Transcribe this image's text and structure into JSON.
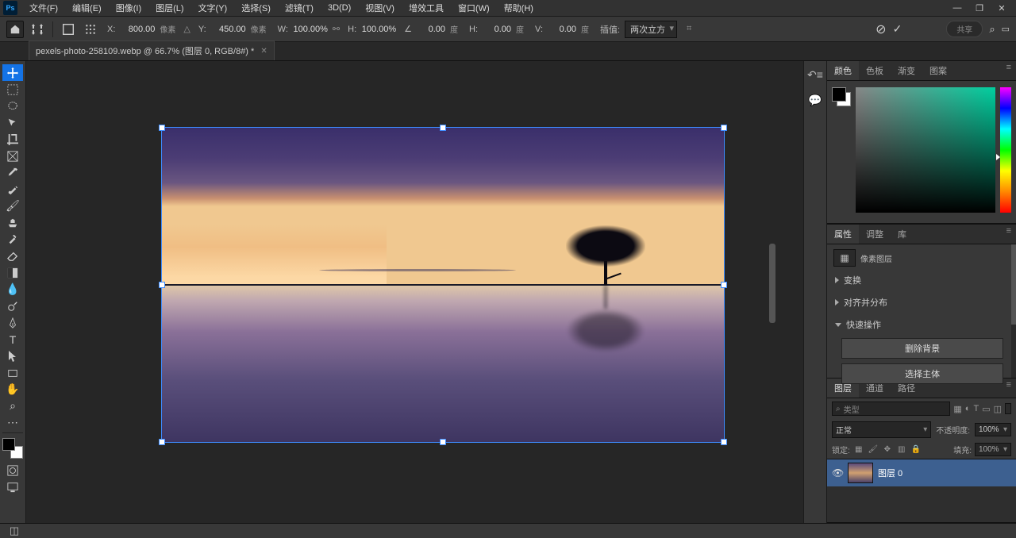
{
  "menu": [
    "文件(F)",
    "编辑(E)",
    "图像(I)",
    "图层(L)",
    "文字(Y)",
    "选择(S)",
    "滤镜(T)",
    "3D(D)",
    "视图(V)",
    "增效工具",
    "窗口(W)",
    "帮助(H)"
  ],
  "options": {
    "x": {
      "label": "X:",
      "value": "800.00",
      "unit": "像素"
    },
    "y": {
      "label": "Y:",
      "value": "450.00",
      "unit": "像素"
    },
    "w": {
      "label": "W:",
      "value": "100.00%"
    },
    "h": {
      "label": "H:",
      "value": "100.00%"
    },
    "angle": {
      "label": "∠",
      "value": "0.00",
      "unit": "度"
    },
    "skewH": {
      "label": "H:",
      "value": "0.00",
      "unit": "度"
    },
    "skewV": {
      "label": "V:",
      "value": "0.00",
      "unit": "度"
    },
    "interp": {
      "label": "插值:",
      "value": "两次立方"
    },
    "share": "共享"
  },
  "docTab": "pexels-photo-258109.webp @ 66.7% (图层 0, RGB/8#) *",
  "colorPanel": {
    "tabs": [
      "颜色",
      "色板",
      "渐变",
      "图案"
    ]
  },
  "propsPanel": {
    "tabs": [
      "属性",
      "调整",
      "库"
    ],
    "type": "像素图层",
    "sections": [
      "变换",
      "对齐并分布",
      "快速操作"
    ],
    "quick": {
      "removeBg": "删除背景",
      "selectSubject": "选择主体"
    }
  },
  "layersPanel": {
    "tabs": [
      "图层",
      "通道",
      "路径"
    ],
    "searchPlaceholder": "类型",
    "blend": "正常",
    "opacityLabel": "不透明度:",
    "opacity": "100%",
    "lockLabel": "锁定:",
    "fillLabel": "填充:",
    "fill": "100%",
    "layer": "图层 0"
  }
}
